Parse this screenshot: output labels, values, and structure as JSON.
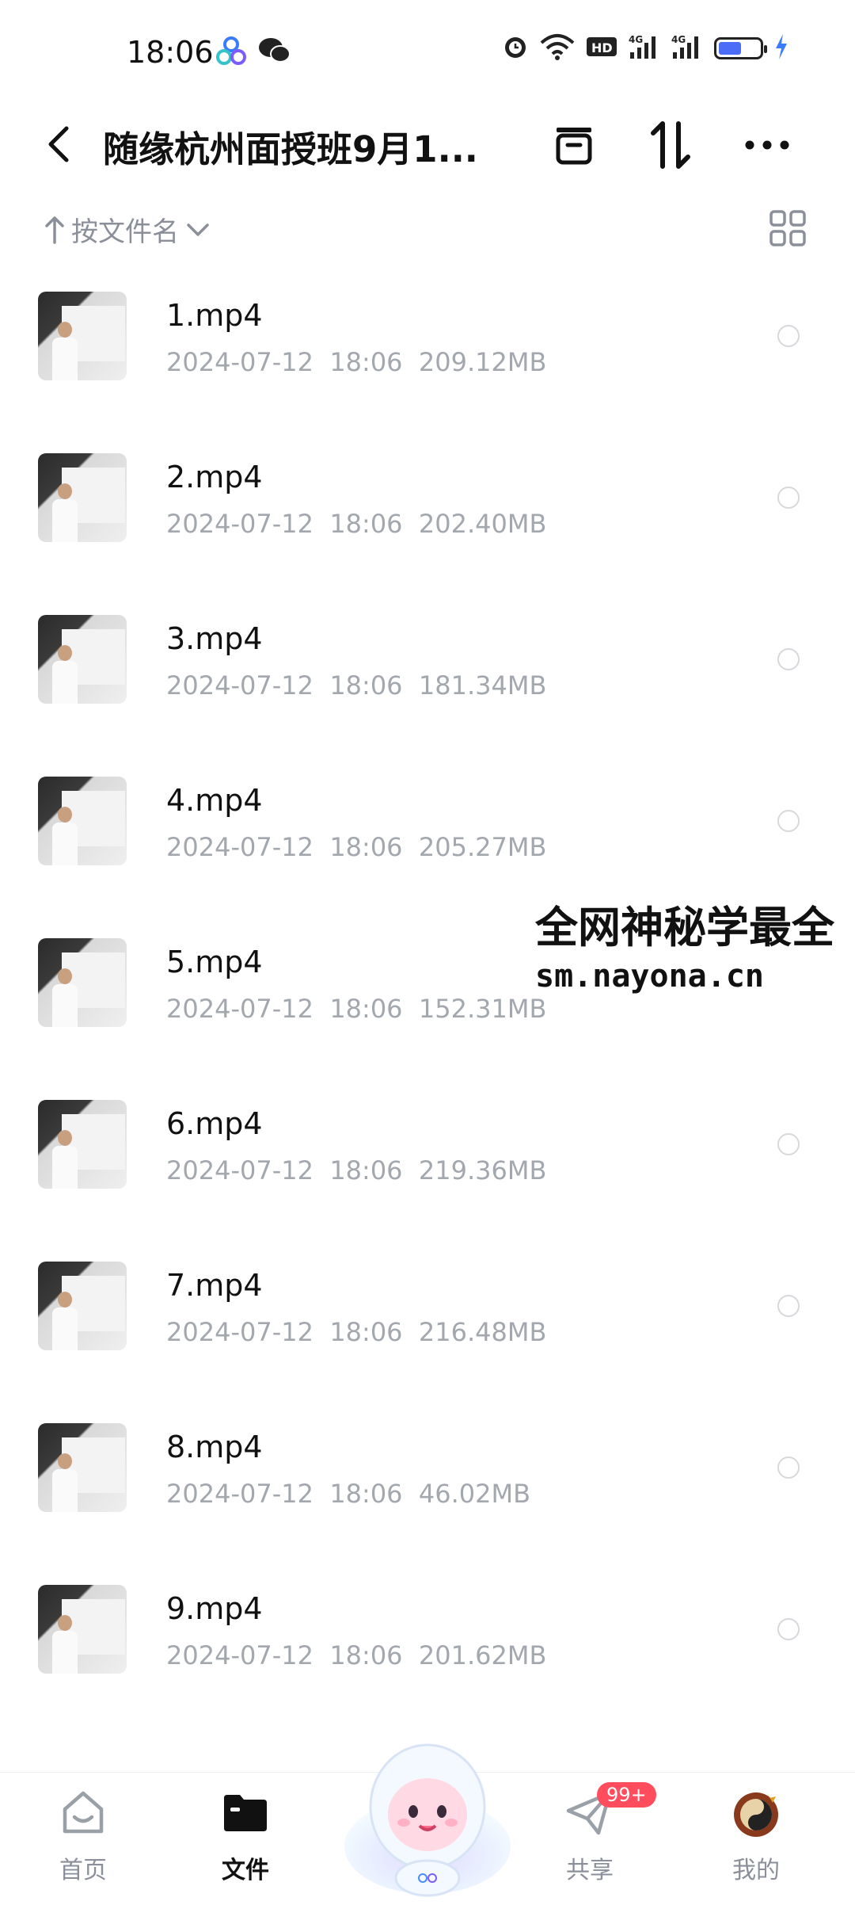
{
  "status_bar": {
    "time": "18:06",
    "icons_left": [
      "cloud-app-icon",
      "wechat-icon"
    ],
    "icons_right": [
      "alarm-icon",
      "wifi-icon",
      "hd-icon",
      "signal-4g-icon",
      "signal-4g-icon",
      "battery-icon",
      "charging-icon"
    ],
    "battery_level": 0.55,
    "battery_color": "#4a6cf7"
  },
  "header": {
    "title": "随缘杭州面授班9月1..."
  },
  "sortbar": {
    "label": "按文件名"
  },
  "files": [
    {
      "name": "1.mp4",
      "date": "2024-07-12",
      "time": "18:06",
      "size": "209.12MB"
    },
    {
      "name": "2.mp4",
      "date": "2024-07-12",
      "time": "18:06",
      "size": "202.40MB"
    },
    {
      "name": "3.mp4",
      "date": "2024-07-12",
      "time": "18:06",
      "size": "181.34MB"
    },
    {
      "name": "4.mp4",
      "date": "2024-07-12",
      "time": "18:06",
      "size": "205.27MB"
    },
    {
      "name": "5.mp4",
      "date": "2024-07-12",
      "time": "18:06",
      "size": "152.31MB"
    },
    {
      "name": "6.mp4",
      "date": "2024-07-12",
      "time": "18:06",
      "size": "219.36MB"
    },
    {
      "name": "7.mp4",
      "date": "2024-07-12",
      "time": "18:06",
      "size": "216.48MB"
    },
    {
      "name": "8.mp4",
      "date": "2024-07-12",
      "time": "18:06",
      "size": "46.02MB"
    },
    {
      "name": "9.mp4",
      "date": "2024-07-12",
      "time": "18:06",
      "size": "201.62MB"
    }
  ],
  "watermark": {
    "line1": "全网神秘学最全",
    "line2": "sm.nayona.cn"
  },
  "bottom_nav": {
    "items": [
      {
        "label": "首页",
        "icon": "home-icon"
      },
      {
        "label": "文件",
        "icon": "folder-icon",
        "active": true
      },
      {
        "label": "共享",
        "icon": "share-icon",
        "badge": "99+"
      },
      {
        "label": "我的",
        "icon": "avatar"
      }
    ]
  },
  "colors": {
    "accent_badge": "#ff4d5e",
    "muted_text": "#a3a7ae"
  }
}
